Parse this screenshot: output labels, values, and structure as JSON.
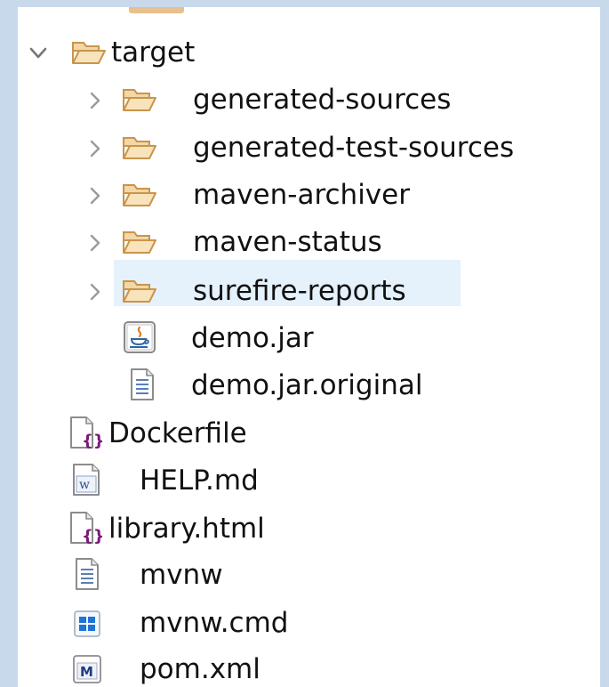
{
  "tree": {
    "target": {
      "label": "target",
      "expanded": true,
      "icon": "open-folder-icon"
    },
    "target_children": [
      {
        "label": "generated-sources",
        "type": "folder",
        "icon": "open-folder-icon"
      },
      {
        "label": "generated-test-sources",
        "type": "folder",
        "icon": "open-folder-icon"
      },
      {
        "label": "maven-archiver",
        "type": "folder",
        "icon": "open-folder-icon"
      },
      {
        "label": "maven-status",
        "type": "folder",
        "icon": "open-folder-icon"
      },
      {
        "label": "surefire-reports",
        "type": "folder",
        "icon": "open-folder-icon",
        "selected": true
      },
      {
        "label": "demo.jar",
        "type": "jar",
        "icon": "java-archive-icon"
      },
      {
        "label": "demo.jar.original",
        "type": "text",
        "icon": "text-file-icon"
      }
    ],
    "root_files": [
      {
        "label": "Dockerfile",
        "icon": "brace-file-icon"
      },
      {
        "label": "HELP.md",
        "icon": "markdown-wiki-file-icon"
      },
      {
        "label": "library.html",
        "icon": "brace-file-icon"
      },
      {
        "label": "mvnw",
        "icon": "text-file-icon"
      },
      {
        "label": "mvnw.cmd",
        "icon": "windows-cmd-file-icon"
      },
      {
        "label": "pom.xml",
        "icon": "maven-pom-file-icon"
      }
    ]
  },
  "colors": {
    "background": "#c9d9ec",
    "panel": "#ffffff",
    "selection": "#e5f1fb",
    "folder_fill": "#f3d7a6",
    "folder_stroke": "#c9954b",
    "chevron": "#9a9a9a"
  }
}
